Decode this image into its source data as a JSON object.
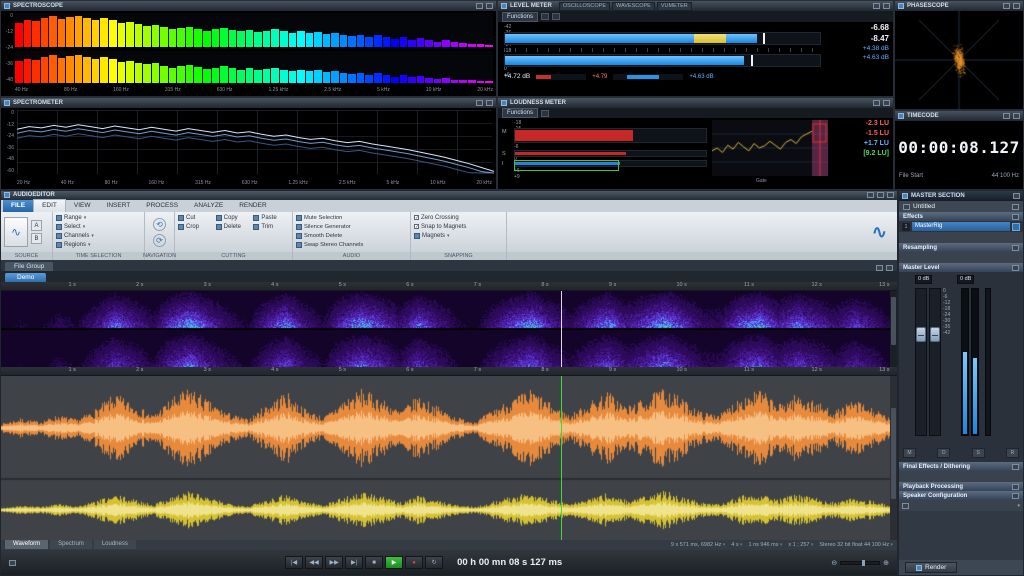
{
  "spectroscope": {
    "title": "SPECTROSCOPE",
    "db_labels": [
      "0",
      "-12",
      "-24",
      "-36",
      "-48"
    ],
    "freq_labels": [
      "40 Hz",
      "80 Hz",
      "160 Hz",
      "315 Hz",
      "630 Hz",
      "1.25 kHz",
      "2.5 kHz",
      "5 kHz",
      "10 kHz",
      "20 kHz"
    ],
    "bars_top": [
      0.72,
      0.8,
      0.76,
      0.85,
      0.9,
      0.82,
      0.88,
      0.92,
      0.86,
      0.8,
      0.84,
      0.78,
      0.7,
      0.74,
      0.68,
      0.62,
      0.66,
      0.58,
      0.52,
      0.56,
      0.6,
      0.54,
      0.48,
      0.52,
      0.56,
      0.5,
      0.46,
      0.5,
      0.44,
      0.48,
      0.52,
      0.46,
      0.42,
      0.46,
      0.4,
      0.44,
      0.38,
      0.42,
      0.36,
      0.32,
      0.36,
      0.3,
      0.34,
      0.28,
      0.24,
      0.28,
      0.22,
      0.26,
      0.2,
      0.16,
      0.2,
      0.14,
      0.12,
      0.1,
      0.08,
      0.06
    ],
    "bars_bottom": [
      0.68,
      0.76,
      0.72,
      0.8,
      0.86,
      0.78,
      0.84,
      0.88,
      0.82,
      0.76,
      0.8,
      0.74,
      0.66,
      0.7,
      0.64,
      0.58,
      0.62,
      0.54,
      0.48,
      0.52,
      0.56,
      0.5,
      0.44,
      0.48,
      0.52,
      0.46,
      0.42,
      0.46,
      0.4,
      0.44,
      0.48,
      0.42,
      0.38,
      0.42,
      0.36,
      0.4,
      0.34,
      0.38,
      0.32,
      0.28,
      0.32,
      0.26,
      0.3,
      0.24,
      0.2,
      0.24,
      0.18,
      0.22,
      0.16,
      0.12,
      0.16,
      0.1,
      0.09,
      0.08,
      0.06,
      0.05
    ]
  },
  "spectrometer": {
    "title": "SPECTROMETER",
    "db_labels": [
      "0",
      "-12",
      "-24",
      "-36",
      "-48",
      "-60"
    ],
    "freq_labels": [
      "20 Hz",
      "40 Hz",
      "80 Hz",
      "160 Hz",
      "315 Hz",
      "630 Hz",
      "1.25 kHz",
      "2.5 kHz",
      "5 kHz",
      "10 kHz",
      "20 kHz"
    ],
    "curve": [
      0.3,
      0.26,
      0.28,
      0.24,
      0.27,
      0.23,
      0.26,
      0.29,
      0.25,
      0.28,
      0.31,
      0.27,
      0.3,
      0.33,
      0.29,
      0.32,
      0.35,
      0.32,
      0.36,
      0.34,
      0.38,
      0.41,
      0.39,
      0.43,
      0.46,
      0.44,
      0.48,
      0.51,
      0.49,
      0.53,
      0.56,
      0.59,
      0.62,
      0.66,
      0.7,
      0.74,
      0.79,
      0.84,
      0.9,
      0.96
    ]
  },
  "level_meter": {
    "title": "LEVEL METER",
    "tabs": [
      "OSCILLOSCOPE",
      "WAVESCOPE",
      "VUMETER"
    ],
    "functions_label": "Functions",
    "scale": [
      "-42",
      "-36",
      "-30",
      "-24",
      "-18",
      "-12",
      "-6",
      "0",
      "+6"
    ],
    "bar_left": 0.8,
    "bar_right": 0.76,
    "yellow_start": 0.6,
    "yellow_end": 0.7,
    "peak_left": "-6.68",
    "peak_right": "-8.47",
    "readout_left": "+4.38 dB",
    "readout_right": "+4.63 dB",
    "bottom_left": "+4.72 dB",
    "bottom_mid": "+4.79",
    "bottom_right": "+4.63 dB"
  },
  "loudness_meter": {
    "title": "LOUDNESS METER",
    "functions_label": "Functions",
    "scale": [
      "-18",
      "-15",
      "-12",
      "-9",
      "-6",
      "-3",
      "0",
      "+3",
      "+6",
      "+9"
    ],
    "rows": [
      {
        "label": "M",
        "value": 0.62,
        "color": "#c62828"
      },
      {
        "label": "S",
        "value": 0.58,
        "color": "#c62828"
      },
      {
        "label": "I",
        "value": 0.55,
        "color": "#2f7fd6"
      }
    ],
    "readouts": [
      {
        "text": "-2.3 LU",
        "color": "#ff6060"
      },
      {
        "text": "-1.5 LU",
        "color": "#ff6060"
      },
      {
        "text": "+1.7 LU",
        "color": "#6ab0ff"
      },
      {
        "text": "[9.2 LU]",
        "color": "#55d855"
      }
    ],
    "gate_label": "Gate",
    "graph": [
      0.55,
      0.5,
      0.58,
      0.45,
      0.52,
      0.4,
      0.48,
      0.55,
      0.42,
      0.5,
      0.46,
      0.38,
      0.45,
      0.52,
      0.4,
      0.35,
      0.42,
      0.3,
      0.25,
      0.2
    ]
  },
  "phasescope": {
    "title": "PHASESCOPE"
  },
  "timecode": {
    "title": "TIMECODE",
    "value": "00:00:08.127",
    "bottom_left": "File Start",
    "bottom_right": "44 100 Hz"
  },
  "editor": {
    "title": "AUDIOEDITOR",
    "tabs": [
      "FILE",
      "EDIT",
      "VIEW",
      "INSERT",
      "PROCESS",
      "ANALYZE",
      "RENDER"
    ],
    "active_tab": "EDIT",
    "file_group_tab": "File Group",
    "file_tab": "Demo",
    "ribbon": {
      "ab_buttons": [
        "A",
        "B"
      ],
      "selection_items": [
        "Range",
        "Select",
        "Channels",
        "Regions"
      ],
      "cutting_items": [
        "Cut",
        "Copy",
        "Paste",
        "Crop",
        "Delete",
        "Trim"
      ],
      "audio_items": [
        "Mute Selection",
        "Silence Generator",
        "Smooth Delete",
        "Swap Stereo Channels"
      ],
      "snapping_items": [
        "Zero Crossing",
        "Snap to Magnets",
        "Magnets"
      ],
      "group_labels": [
        "SOURCE",
        "TIME SELECTION",
        "NAVIGATION",
        "CUTTING",
        "AUDIO",
        "SNAPPING"
      ]
    },
    "ruler_seconds": [
      "1 s",
      "2 s",
      "3 s",
      "4 s",
      "5 s",
      "6 s",
      "7 s",
      "8 s",
      "9 s",
      "10 s",
      "11 s",
      "12 s",
      "13 s"
    ],
    "view_tabs": [
      "Waveform",
      "Spectrum",
      "Loudness"
    ],
    "active_view_tab": "Waveform",
    "status_items": [
      "9 x 571 ms, 6982 Hz",
      "4 s",
      "1 ns 946 ms",
      "x 1 ; 257",
      "Stereo 32 bit float 44 100 Hz"
    ],
    "playhead": 0.625
  },
  "transport": {
    "time": "00 h 00 mn 08 s 127 ms",
    "buttons": [
      "prev",
      "rewind",
      "forward",
      "next",
      "stop",
      "play",
      "record",
      "loop"
    ]
  },
  "master": {
    "title": "MASTER SECTION",
    "preset": "Untitled",
    "sections": [
      "Effects",
      "Resampling",
      "Master Level",
      "Final Effects / Dithering",
      "Playback Processing",
      "Speaker Configuration"
    ],
    "effect_slot": "MasterRig",
    "fader_values": [
      "0 dB",
      "0 dB"
    ],
    "scale": [
      "0",
      "-6",
      "-12",
      "-18",
      "-24",
      "-30",
      "-36",
      "-42"
    ],
    "meters": [
      0.56,
      0.52
    ],
    "meter_buttons": [
      "M",
      "D",
      "S",
      "R"
    ],
    "render_label": "Render"
  },
  "waveform": {
    "envelope_top": [
      0.1,
      0.22,
      0.15,
      0.3,
      0.2,
      0.45,
      0.8,
      0.55,
      0.3,
      0.7,
      0.95,
      0.6,
      0.35,
      0.2,
      0.55,
      0.85,
      0.45,
      0.25,
      0.65,
      0.9,
      0.7,
      0.4,
      0.75,
      0.5,
      0.25,
      0.15,
      0.45,
      0.7,
      0.9,
      0.55,
      0.3,
      0.6,
      0.85,
      0.5,
      0.7,
      0.95,
      0.65,
      0.35,
      0.35,
      0.75,
      0.9,
      0.55,
      0.8,
      0.6,
      0.4,
      0.65,
      0.45,
      0.2
    ],
    "envelope_bottom": [
      0.08,
      0.18,
      0.12,
      0.25,
      0.15,
      0.35,
      0.6,
      0.42,
      0.22,
      0.55,
      0.75,
      0.45,
      0.28,
      0.15,
      0.42,
      0.65,
      0.35,
      0.2,
      0.5,
      0.7,
      0.55,
      0.3,
      0.58,
      0.38,
      0.2,
      0.12,
      0.35,
      0.55,
      0.7,
      0.42,
      0.24,
      0.46,
      0.66,
      0.38,
      0.55,
      0.75,
      0.5,
      0.28,
      0.28,
      0.58,
      0.7,
      0.42,
      0.62,
      0.46,
      0.3,
      0.5,
      0.35,
      0.15
    ],
    "color_top": "#e88a3c",
    "color_top_core": "#f7c083",
    "color_bottom": "#d6c231",
    "color_bottom_core": "#efe48d"
  }
}
